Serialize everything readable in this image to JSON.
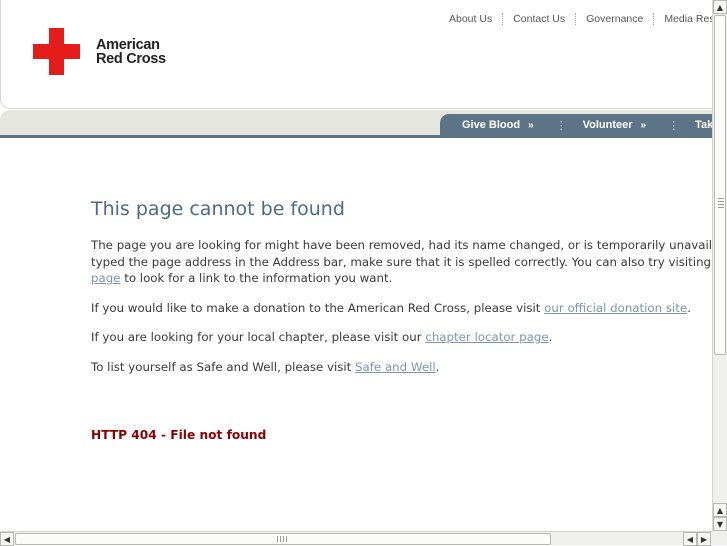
{
  "brand": {
    "logo_line1": "American",
    "logo_line2": "Red Cross",
    "cross_color": "#e41d1b",
    "cross_icon": "red-cross-icon"
  },
  "top_links": [
    {
      "label": "About Us"
    },
    {
      "label": "Contact Us"
    },
    {
      "label": "Governance"
    },
    {
      "label": "Media Reso"
    }
  ],
  "nav": {
    "items": [
      {
        "label": "Give Blood",
        "arrow": "»"
      },
      {
        "label": "Volunteer",
        "arrow": "»"
      },
      {
        "label": "Take a"
      }
    ],
    "separator": "⋮",
    "tab_color": "#5d7487"
  },
  "main": {
    "title": "This page cannot be found",
    "p1_line1": "The page you are looking for might have been removed, had its name changed, or is temporarily unavailable",
    "p1_line2": "typed the page address in the Address bar, make sure that it is spelled correctly. You can also try visiting the",
    "p1_link": "page",
    "p1_tail": " to look for a link to the information you want.",
    "p2_pre": "If you would like to make a donation to the American Red Cross, please visit ",
    "p2_link": "our official donation site",
    "p2_post": ".",
    "p3_pre": "If you are looking for your local chapter, please visit our ",
    "p3_link": "chapter locator page",
    "p3_post": ".",
    "p4_pre": "To list yourself as Safe and Well, please visit ",
    "p4_link": "Safe and Well",
    "p4_post": ".",
    "error": "HTTP 404 - File not found"
  },
  "scrollbars": {
    "up_arrow": "▲",
    "down_arrow": "▼",
    "left_arrow": "◀",
    "right_arrow": "▶"
  }
}
